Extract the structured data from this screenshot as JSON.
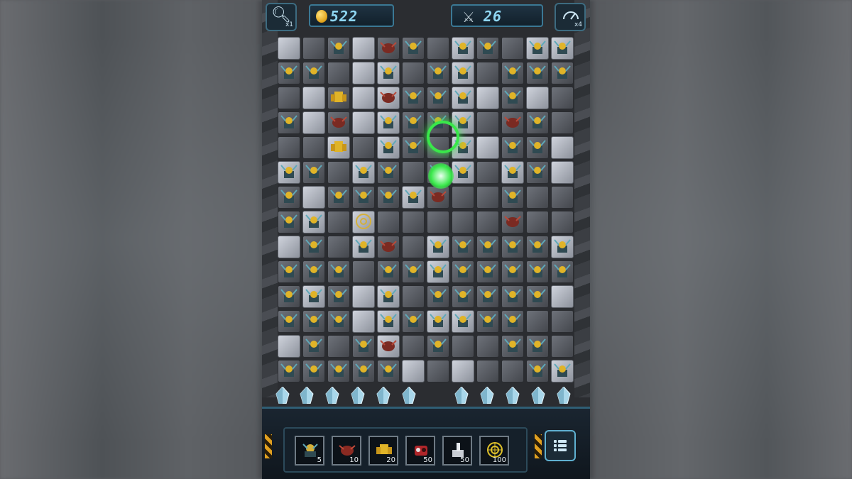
{
  "hud": {
    "zoom_multiplier": "x1",
    "coins": "522",
    "kills": "26",
    "speed_multiplier": "x4"
  },
  "icons": {
    "zoom": "magnifier-icon",
    "coin": "coin-icon",
    "kills": "crossed-swords-icon",
    "speed": "speedometer-icon",
    "menu": "menu-list-icon"
  },
  "shop": {
    "units": [
      {
        "name": "soldier-mech",
        "cost": "5"
      },
      {
        "name": "red-crab-bot",
        "cost": "10"
      },
      {
        "name": "gold-mech",
        "cost": "20"
      },
      {
        "name": "red-heavy-bot",
        "cost": "50"
      },
      {
        "name": "cannon-turret",
        "cost": "50"
      },
      {
        "name": "radar-disc",
        "cost": "100"
      }
    ]
  },
  "colors": {
    "accent": "#3b7894",
    "coin": "#e0a21a",
    "counter_text": "#8fd6f2",
    "effect_green": "#39e84a"
  }
}
